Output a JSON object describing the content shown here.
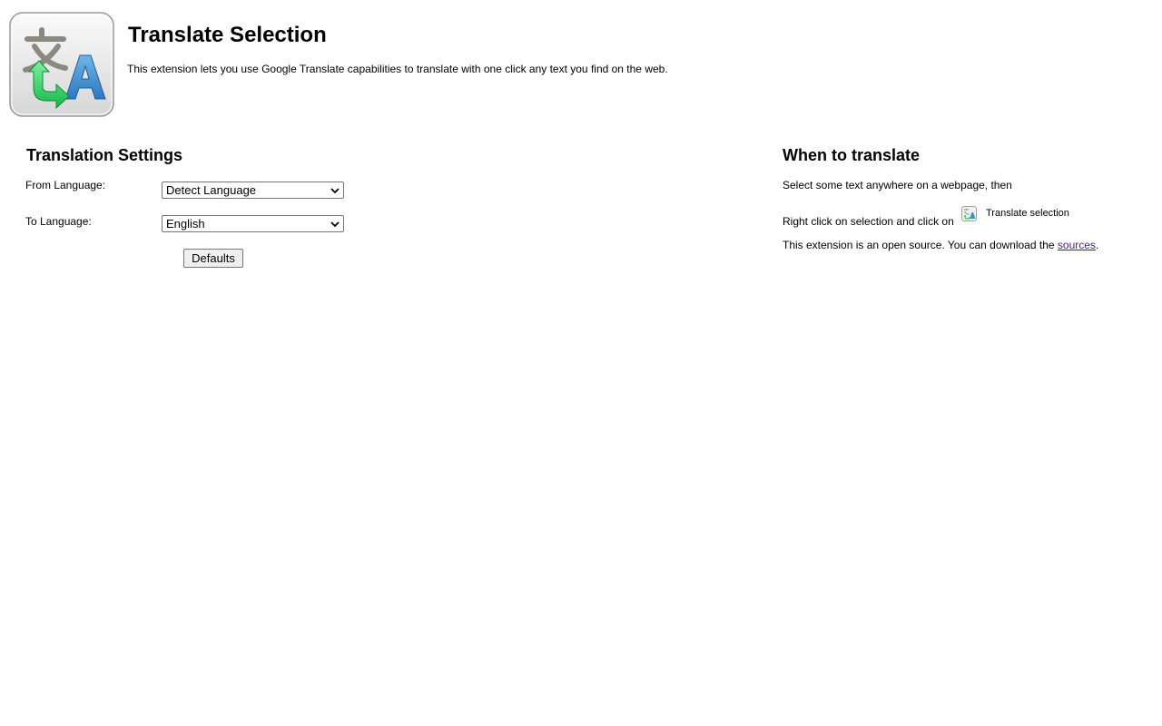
{
  "header": {
    "title": "Translate Selection",
    "description": "This extension lets you use Google Translate capabilities to translate with one click any text you find on the web.",
    "logo_icon": "translate-logo-icon"
  },
  "settings": {
    "title": "Translation Settings",
    "from_label": "From Language:",
    "from_value": "Detect Language",
    "to_label": "To Language:",
    "to_value": "English",
    "defaults_label": "Defaults"
  },
  "when": {
    "title": "When to translate",
    "step1": "Select some text anywhere on a webpage, then",
    "step2": "Right click on selection and click on",
    "menu_item_label": "Translate selection",
    "menu_item_icon": "translate-small-icon",
    "opensource_prefix": "This extension is an open source. You can download the ",
    "sources_link": "sources",
    "opensource_suffix": "."
  },
  "colors": {
    "link_visited": "#551a8b",
    "logo_green": "#3fd66a",
    "logo_blue": "#3a8fd0",
    "logo_gray": "#8a8a80"
  }
}
